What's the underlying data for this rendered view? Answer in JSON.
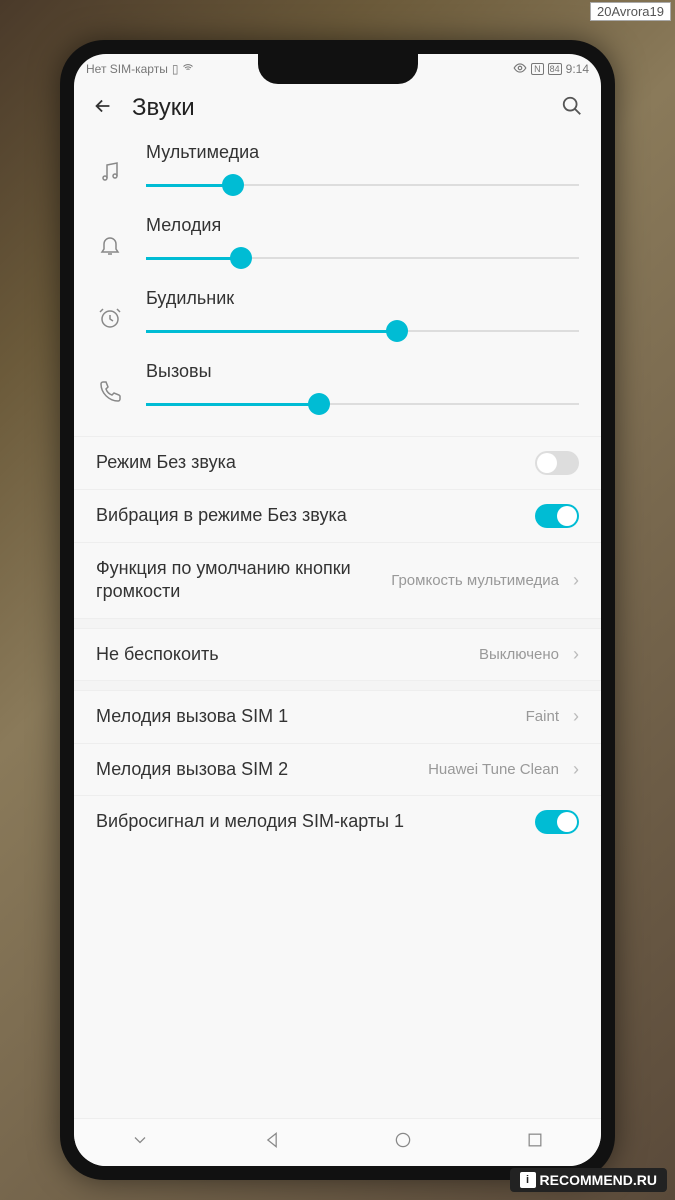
{
  "watermark_top": "20Avrora19",
  "watermark_bottom": "RECOMMEND.RU",
  "statusbar": {
    "sim_text": "Нет SIM-карты",
    "battery": "84",
    "time": "9:14"
  },
  "header": {
    "title": "Звуки"
  },
  "sliders": [
    {
      "label": "Мультимедиа",
      "percent": 20,
      "icon": "music"
    },
    {
      "label": "Мелодия",
      "percent": 22,
      "icon": "bell"
    },
    {
      "label": "Будильник",
      "percent": 58,
      "icon": "alarm"
    },
    {
      "label": "Вызовы",
      "percent": 40,
      "icon": "phone"
    }
  ],
  "settings": {
    "silent": {
      "label": "Режим Без звука",
      "on": false
    },
    "vibrate_silent": {
      "label": "Вибрация в режиме Без звука",
      "on": true
    },
    "volume_default": {
      "label": "Функция по умолчанию кнопки громкости",
      "value": "Громкость мультимедиа"
    },
    "dnd": {
      "label": "Не беспокоить",
      "value": "Выключено"
    },
    "sim1_ring": {
      "label": "Мелодия вызова SIM 1",
      "value": "Faint"
    },
    "sim2_ring": {
      "label": "Мелодия вызова SIM 2",
      "value": "Huawei Tune Clean"
    },
    "sim1_vibrate": {
      "label": "Вибросигнал и мелодия SIM-карты 1",
      "on": true
    }
  }
}
